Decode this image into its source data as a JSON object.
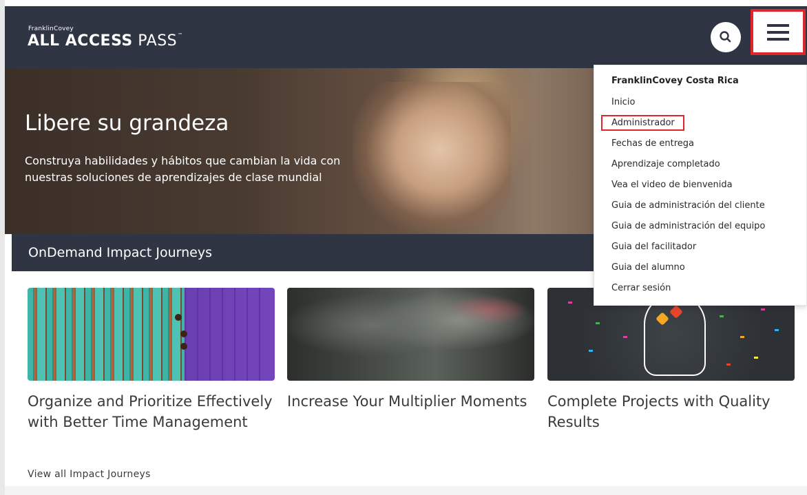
{
  "header": {
    "logo_small": "FranklinCovey",
    "logo_strong": "ALL ACCESS",
    "logo_thin": "PASS",
    "logo_tm": "™",
    "search_icon": "search-icon",
    "menu_icon": "hamburger-menu-icon"
  },
  "hero": {
    "title": "Libere su grandeza",
    "text": "Construya habilidades y hábitos que cambian la vida con nuestras soluciones de aprendizajes de clase mundial"
  },
  "section": {
    "title": "OnDemand Impact Journeys"
  },
  "cards": [
    {
      "title": "Organize and Prioritize Effectively with Better Time Management"
    },
    {
      "title": "Increase Your Multiplier Moments"
    },
    {
      "title": "Complete Projects with Quality Results"
    }
  ],
  "view_all": "View all Impact Journeys",
  "menu": {
    "heading": "FranklinCovey Costa Rica",
    "items": [
      {
        "label": "Inicio"
      },
      {
        "label": "Administrador"
      },
      {
        "label": "Fechas de entrega"
      },
      {
        "label": "Aprendizaje completado"
      },
      {
        "label": "Vea el video de bienvenida"
      },
      {
        "label": "Guia de administración del cliente"
      },
      {
        "label": "Guia de administración del equipo"
      },
      {
        "label": "Guia del facilitador"
      },
      {
        "label": "Guia del alumno"
      },
      {
        "label": "Cerrar sesión"
      }
    ]
  },
  "colors": {
    "navy": "#2f3542",
    "highlight": "#e0252d"
  }
}
